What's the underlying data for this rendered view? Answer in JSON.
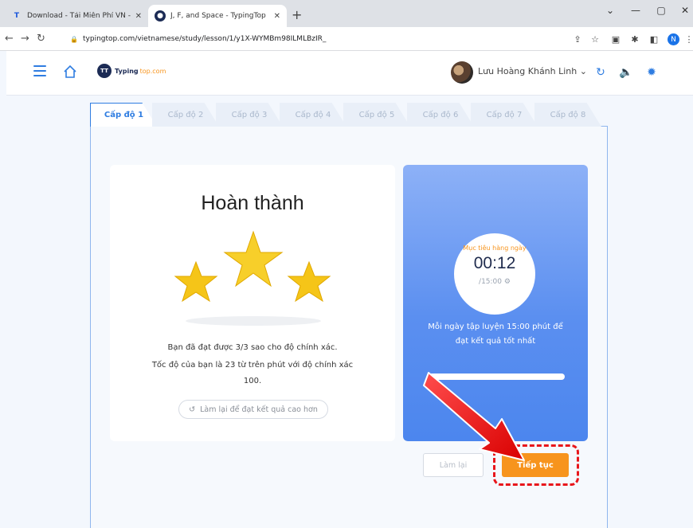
{
  "browser": {
    "tabs": [
      {
        "title": "Download - Tải Miễn Phí VN - Ph",
        "favicon": "T",
        "color": "#1a56db"
      },
      {
        "title": "J, F, and Space - TypingTop",
        "favicon": "•",
        "color": "#1c2b55"
      }
    ],
    "url": "typingtop.com/vietnamese/study/lesson/1/y1X-WYMBm98ILMLBzIR_",
    "profile_initial": "N"
  },
  "header": {
    "logo_text": "Typing",
    "logo_sub": "top.com",
    "user_name": "Lưu Hoàng Khánh Linh"
  },
  "levels": [
    "Cấp độ 1",
    "Cấp độ 2",
    "Cấp độ 3",
    "Cấp độ 4",
    "Cấp độ 5",
    "Cấp độ 6",
    "Cấp độ 7",
    "Cấp độ 8"
  ],
  "result": {
    "title": "Hoàn thành",
    "stars_earned": 3,
    "stars_total": 3,
    "line1": "Bạn đã đạt được 3/3 sao cho độ chính xác.",
    "line2": "Tốc độ của bạn là 23 từ trên phút với độ chính xác",
    "line3": "100.",
    "retry_label": "Làm lại để đạt kết quả cao hơn"
  },
  "goal": {
    "label": "Mục tiêu hàng ngày",
    "time": "00:12",
    "target": "/15:00",
    "motto_1": "Mỗi ngày tập luyện 15:00 phút để",
    "motto_2": "đạt kết quả tốt nhất",
    "progress": 0.013
  },
  "actions": {
    "again_label": "Làm lại",
    "continue_label": "Tiếp tục"
  },
  "colors": {
    "accent": "#2f7de1",
    "orange": "#f7941d",
    "highlight_red": "#e8161b"
  }
}
